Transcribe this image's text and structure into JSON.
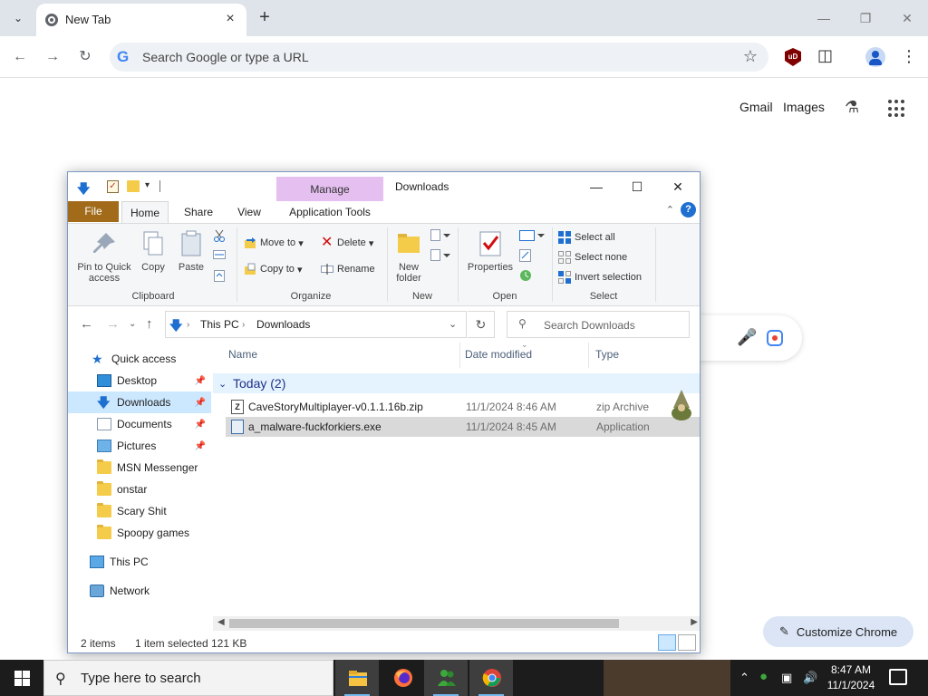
{
  "chrome": {
    "tab_title": "New Tab",
    "omnibox_placeholder": "Search Google or type a URL",
    "ublock_label": "uD",
    "customize_label": "Customize Chrome"
  },
  "ntp": {
    "gmail": "Gmail",
    "images": "Images"
  },
  "explorer": {
    "title": "Downloads",
    "manage_tab": "Manage",
    "ribbon_tabs": [
      "File",
      "Home",
      "Share",
      "View",
      "Application Tools"
    ],
    "clipboard": {
      "pin": "Pin to Quick access",
      "copy": "Copy",
      "paste": "Paste",
      "label": "Clipboard"
    },
    "organize": {
      "move_to": "Move to",
      "copy_to": "Copy to",
      "delete": "Delete",
      "rename": "Rename",
      "label": "Organize"
    },
    "new": {
      "new_folder": "New folder",
      "label": "New"
    },
    "open": {
      "properties": "Properties",
      "label": "Open"
    },
    "select": {
      "select_all": "Select all",
      "select_none": "Select none",
      "invert": "Invert selection",
      "label": "Select"
    },
    "address": {
      "this_pc": "This PC",
      "downloads": "Downloads",
      "search_placeholder": "Search Downloads"
    },
    "nav": {
      "quick_access": "Quick access",
      "items": [
        {
          "label": "Desktop",
          "pinned": true
        },
        {
          "label": "Downloads",
          "pinned": true
        },
        {
          "label": "Documents",
          "pinned": true
        },
        {
          "label": "Pictures",
          "pinned": true
        },
        {
          "label": "MSN Messenger",
          "pinned": false
        },
        {
          "label": "onstar",
          "pinned": false
        },
        {
          "label": "Scary Shit",
          "pinned": false
        },
        {
          "label": "Spoopy games",
          "pinned": false
        }
      ],
      "this_pc": "This PC",
      "network": "Network"
    },
    "columns": {
      "name": "Name",
      "date": "Date modified",
      "type": "Type"
    },
    "group": "Today (2)",
    "files": [
      {
        "name": "CaveStoryMultiplayer-v0.1.1.16b.zip",
        "date": "11/1/2024 8:46 AM",
        "type": "zip Archive"
      },
      {
        "name": "a_malware-fuckforkiers.exe",
        "date": "11/1/2024 8:45 AM",
        "type": "Application"
      }
    ],
    "status": {
      "items": "2 items",
      "selected": "1 item selected",
      "size": "121 KB"
    }
  },
  "taskbar": {
    "search_placeholder": "Type here to search",
    "time": "8:47 AM",
    "date": "11/1/2024"
  }
}
